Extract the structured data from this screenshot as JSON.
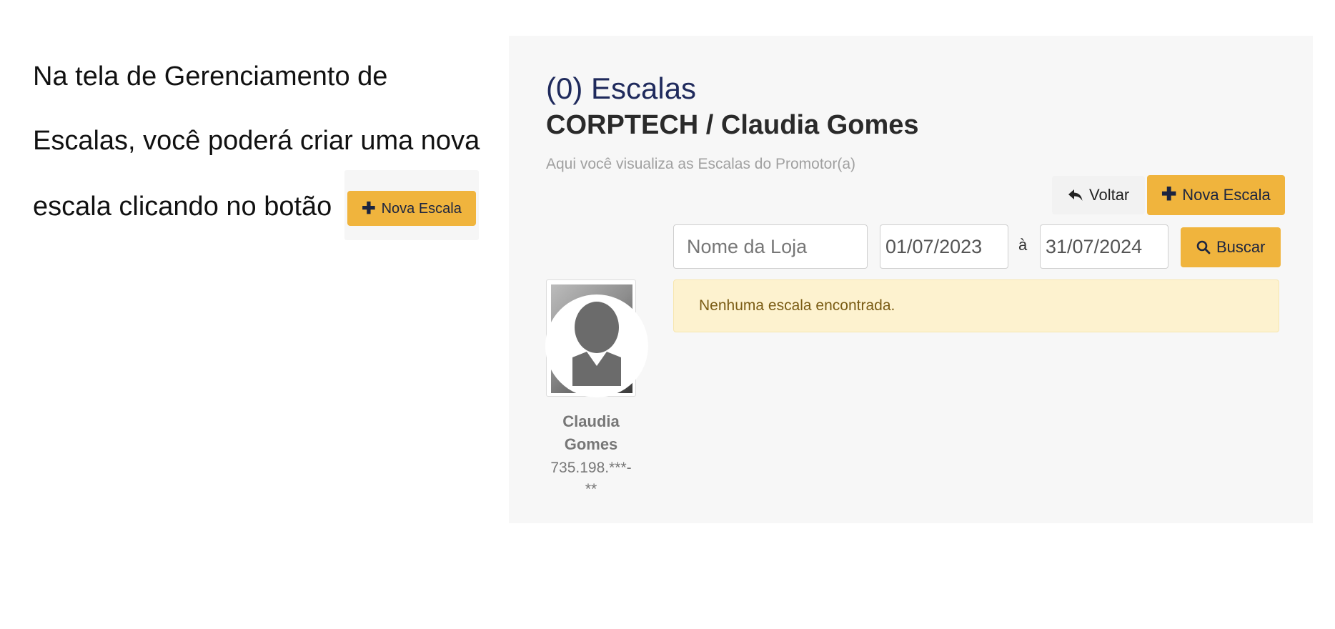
{
  "instructions": {
    "line1": "Na tela de Gerenciamento de",
    "line2": "Escalas, você poderá criar uma nova",
    "line3": "escala clicando no botão",
    "inline_button_label": "Nova Escala"
  },
  "panel": {
    "title": "(0) Escalas",
    "subtitle": "CORPTECH / Claudia Gomes",
    "description": "Aqui você visualiza as Escalas do Promotor(a)",
    "back_label": "Voltar",
    "new_label": "Nova Escala"
  },
  "filters": {
    "store_placeholder": "Nome da Loja",
    "date_from": "01/07/2023",
    "separator": "à",
    "date_to": "31/07/2024",
    "search_label": "Buscar"
  },
  "alert": {
    "message": "Nenhuma escala encontrada."
  },
  "user": {
    "name_line1": "Claudia",
    "name_line2": "Gomes",
    "doc_line1": "735.198.***-",
    "doc_line2": "**"
  },
  "colors": {
    "accent": "#f0b43d",
    "title": "#1f2a5c",
    "alert_bg": "#fdf2cf",
    "panel_bg": "#f7f7f7"
  },
  "icons": [
    "plus-icon",
    "reply-icon",
    "search-icon",
    "user-avatar-icon"
  ]
}
